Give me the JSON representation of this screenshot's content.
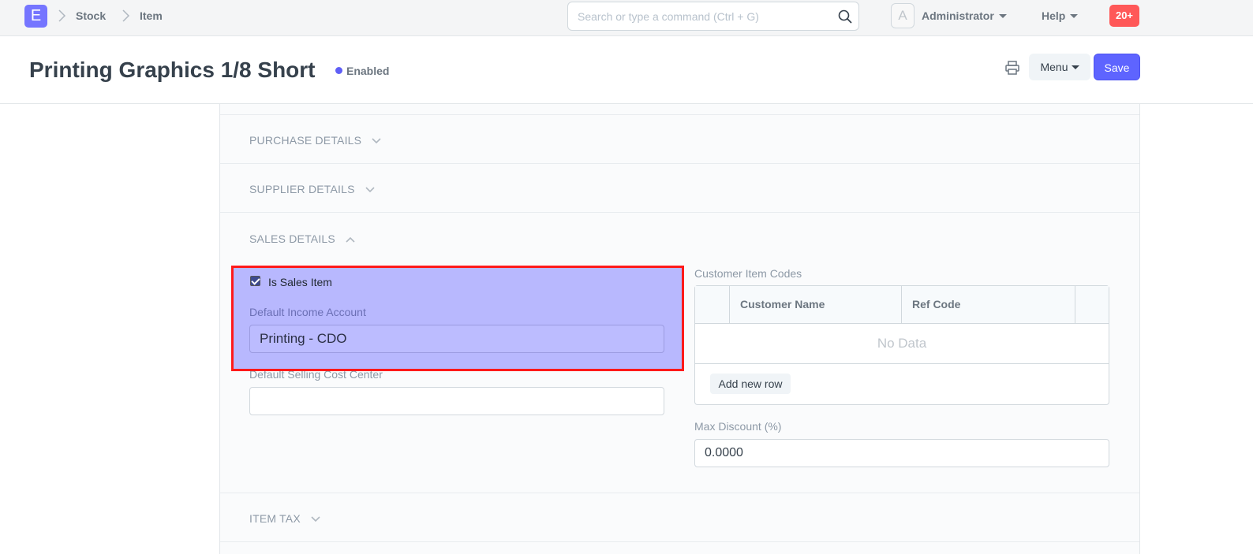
{
  "navbar": {
    "logo_letter": "E",
    "breadcrumbs": [
      "Stock",
      "Item"
    ],
    "search_placeholder": "Search or type a command (Ctrl + G)",
    "avatar_letter": "A",
    "user_label": "Administrator",
    "help_label": "Help",
    "notification_count": "20+"
  },
  "page": {
    "title": "Printing Graphics 1/8 Short",
    "status": "Enabled",
    "menu_label": "Menu",
    "save_label": "Save"
  },
  "sections": {
    "purchase": "PURCHASE DETAILS",
    "supplier": "SUPPLIER DETAILS",
    "sales": "SALES DETAILS",
    "item_tax": "ITEM TAX"
  },
  "sales": {
    "is_sales_item_label": "Is Sales Item",
    "is_sales_item_checked": true,
    "default_income_account_label": "Default Income Account",
    "default_income_account_value": "Printing - CDO",
    "default_selling_cost_center_label": "Default Selling Cost Center",
    "default_selling_cost_center_value": "",
    "customer_item_codes_label": "Customer Item Codes",
    "grid_columns": [
      "Customer Name",
      "Ref Code"
    ],
    "grid_empty": "No Data",
    "add_row_label": "Add new row",
    "max_discount_label": "Max Discount (%)",
    "max_discount_value": "0.0000"
  },
  "colors": {
    "accent": "#5e64ff",
    "notification": "#ff5858",
    "highlight_border": "#ff1a1a"
  },
  "icons": [
    "chevron-right-icon",
    "search-icon",
    "caret-down-icon",
    "printer-icon",
    "chevron-down-icon",
    "chevron-up-icon",
    "checkmark-icon"
  ]
}
